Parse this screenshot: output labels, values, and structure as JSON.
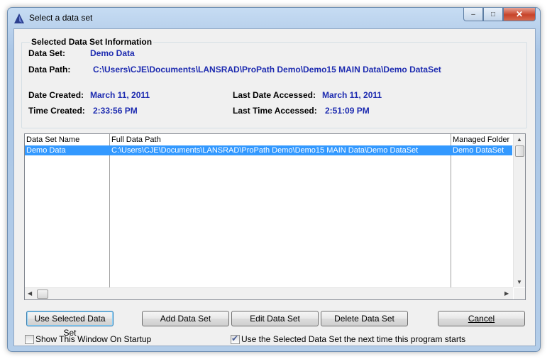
{
  "window": {
    "title": "Select a data set",
    "minimize_label": "‒",
    "maximize_label": "□",
    "close_label": "✕"
  },
  "info": {
    "group_title": "Selected Data Set Information",
    "data_set_label": "Data Set:",
    "data_set_value": "Demo Data",
    "data_path_label": "Data Path:",
    "data_path_value": "C:\\Users\\CJE\\Documents\\LANSRAD\\ProPath Demo\\Demo15 MAIN Data\\Demo DataSet",
    "date_created_label": "Date Created:",
    "date_created_value": "March 11, 2011",
    "last_date_accessed_label": "Last Date Accessed:",
    "last_date_accessed_value": "March 11, 2011",
    "time_created_label": "Time Created:",
    "time_created_value": "2:33:56 PM",
    "last_time_accessed_label": "Last Time Accessed:",
    "last_time_accessed_value": "2:51:09 PM"
  },
  "table": {
    "columns": [
      "Data Set Name",
      "Full Data Path",
      "Managed Folder N"
    ],
    "rows": [
      [
        "Demo Data",
        "C:\\Users\\CJE\\Documents\\LANSRAD\\ProPath Demo\\Demo15 MAIN Data\\Demo DataSet",
        "Demo DataSet"
      ]
    ],
    "selection_color": "#3399ff"
  },
  "buttons": {
    "use_selected": "Use Selected Data Set",
    "add": "Add Data Set",
    "edit": "Edit Data Set",
    "delete": "Delete Data Set",
    "cancel": "Cancel"
  },
  "options": {
    "show_on_startup_label": "Show This Window On Startup",
    "show_on_startup_checked": false,
    "use_next_time_label": "Use the Selected Data Set the next time this program starts",
    "use_next_time_checked": true
  }
}
